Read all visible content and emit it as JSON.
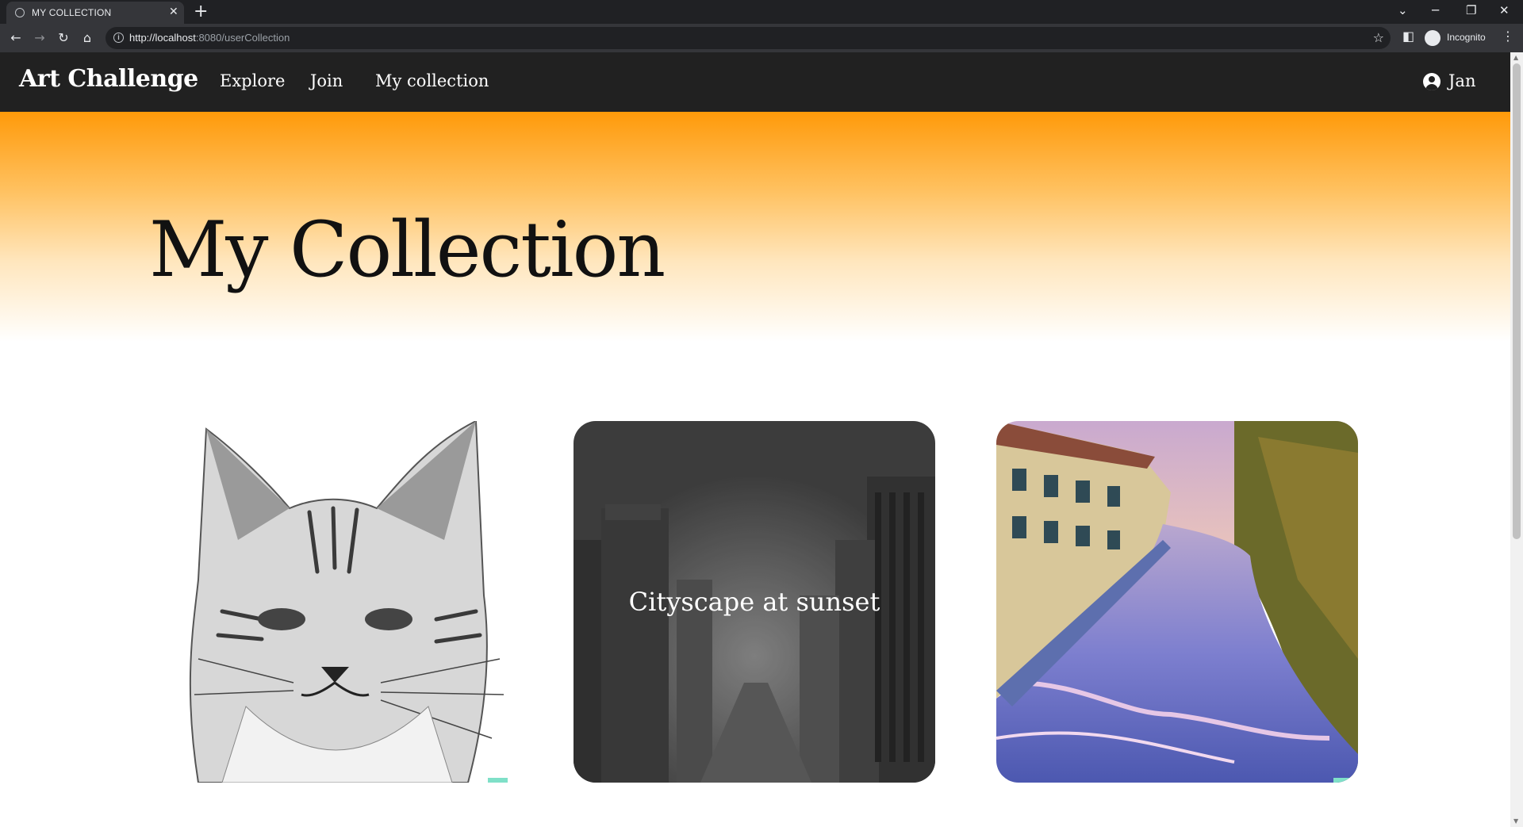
{
  "browser": {
    "tab_title": "MY COLLECTION",
    "url_host": "http://localhost",
    "url_path": ":8080/userCollection",
    "profile_label": "Incognito"
  },
  "app": {
    "brand": "Art Challenge",
    "nav": [
      "Explore",
      "Join",
      "My collection"
    ],
    "user_name": "Jan"
  },
  "page": {
    "title": "My Collection"
  },
  "collection": [
    {
      "caption": "",
      "artwork": "pencil sketch of a tabby cat"
    },
    {
      "caption": "Cityscape at sunset",
      "artwork": "grayscale city street with skyscrapers"
    },
    {
      "caption": "",
      "artwork": "impressionist painting of a river through a town"
    }
  ],
  "colors": {
    "nav_bg": "#212121",
    "hero_top": "#ff9a0a",
    "hero_bottom": "#ffffff"
  }
}
